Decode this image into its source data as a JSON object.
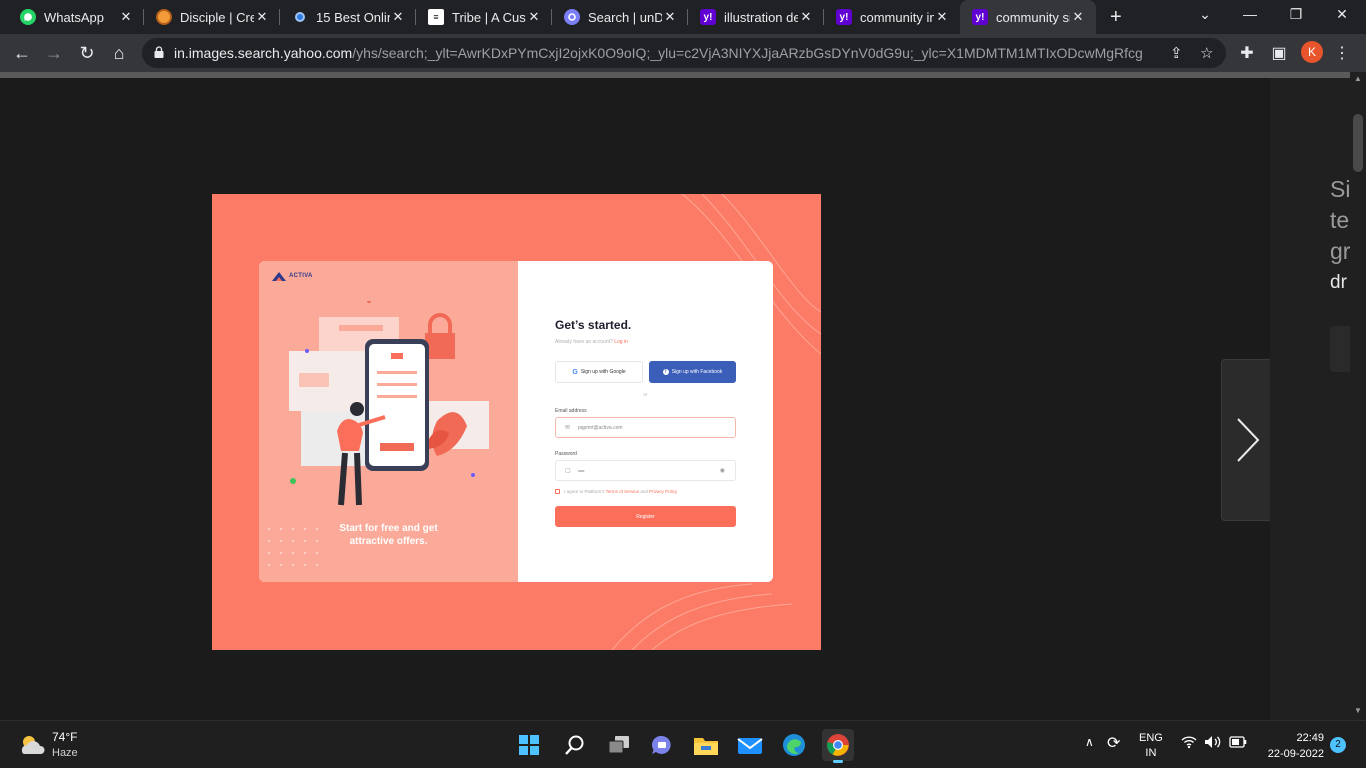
{
  "browser": {
    "tabs": [
      {
        "title": "WhatsApp",
        "icon": "whatsapp-icon",
        "active": false
      },
      {
        "title": "Disciple | Cre",
        "icon": "disciple-icon",
        "active": false
      },
      {
        "title": "15 Best Onlin",
        "icon": "site-icon",
        "active": false
      },
      {
        "title": "Tribe | A Custo",
        "icon": "tribe-icon",
        "active": false
      },
      {
        "title": "Search | unDr",
        "icon": "undraw-icon",
        "active": false
      },
      {
        "title": "illustration de",
        "icon": "yahoo-icon",
        "active": false
      },
      {
        "title": "community in",
        "icon": "yahoo-icon",
        "active": false
      },
      {
        "title": "community si",
        "icon": "yahoo-icon",
        "active": true
      }
    ],
    "url_host": "in.images.search.yahoo.com",
    "url_path": "/yhs/search;_ylt=AwrKDxPYmCxjI2ojxK0O9oIQ;_ylu=c2VjA3NIYXJjaARzbGsDYnV0dG9u;_ylc=X1MDMTM1MTIxODcwMgRfcgMyBG...",
    "profile_initial": "K",
    "accent": "#e8542b"
  },
  "side_panel": {
    "lines": [
      "Si",
      "te",
      "gr"
    ],
    "dark_line": "dr"
  },
  "preview": {
    "logo_text": "ACTIVA",
    "tagline_1": "Start for free and get",
    "tagline_2": "attractive offers.",
    "form_title": "Get’s started.",
    "already_text": "Already have an account?",
    "login_link": "Log in",
    "google_button": "Sign up with Google",
    "facebook_button": "Sign up with Facebook",
    "or_text": "or",
    "email_label": "Email address",
    "email_value": "pqpmrt@activa.com",
    "password_label": "Password",
    "password_value": "••••••••••••••",
    "agree_prefix": "I agree to Platform's",
    "terms_link": "Terms of Service",
    "and_text": "and",
    "privacy_link": "Privacy Policy",
    "register_button": "Register",
    "colors": {
      "background": "#fb7b66",
      "panel": "#fbaa9a",
      "button": "#fb6e5a",
      "facebook": "#3b5eb8"
    }
  },
  "taskbar": {
    "temperature": "74°F",
    "condition": "Haze",
    "lang_1": "ENG",
    "lang_2": "IN",
    "time": "22:49",
    "date": "22-09-2022",
    "notification_count": "2"
  }
}
